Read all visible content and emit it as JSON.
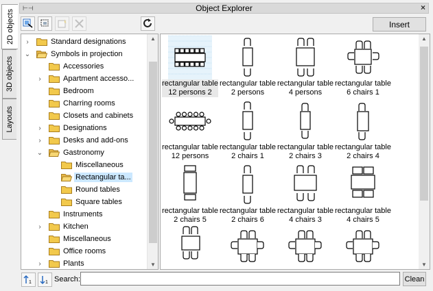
{
  "window": {
    "title": "Object Explorer"
  },
  "side_tabs": [
    {
      "label": "2D objects",
      "active": true
    },
    {
      "label": "3D objects",
      "active": false
    },
    {
      "label": "Layouts",
      "active": false
    }
  ],
  "toolbar": {
    "insert_label": "Insert"
  },
  "tree": {
    "items": [
      {
        "label": "Standard designations",
        "expander": "›",
        "open": false
      },
      {
        "label": "Symbols in projection",
        "expander": "⌄",
        "open": true
      },
      {
        "label": "Accessories",
        "expander": "",
        "open": false
      },
      {
        "label": "Apartment accesso...",
        "expander": "›",
        "open": false
      },
      {
        "label": "Bedroom",
        "expander": "",
        "open": false
      },
      {
        "label": "Charring rooms",
        "expander": "",
        "open": false
      },
      {
        "label": "Closets and cabinets",
        "expander": "",
        "open": false
      },
      {
        "label": "Designations",
        "expander": "›",
        "open": false
      },
      {
        "label": "Desks and add-ons",
        "expander": "›",
        "open": false
      },
      {
        "label": "Gastronomy",
        "expander": "⌄",
        "open": true
      },
      {
        "label": "Miscellaneous",
        "expander": "",
        "open": false
      },
      {
        "label": "Rectangular ta...",
        "expander": "",
        "open": true,
        "selected": true
      },
      {
        "label": "Round tables",
        "expander": "",
        "open": false
      },
      {
        "label": "Square tables",
        "expander": "",
        "open": false
      },
      {
        "label": "Instruments",
        "expander": "",
        "open": false
      },
      {
        "label": "Kitchen",
        "expander": "›",
        "open": false
      },
      {
        "label": "Miscellaneous",
        "expander": "",
        "open": false
      },
      {
        "label": "Office rooms",
        "expander": "",
        "open": false
      },
      {
        "label": "Plants",
        "expander": "›",
        "open": false
      }
    ]
  },
  "grid": {
    "items": [
      {
        "line1": "rectangular table",
        "line2": "12 persons 2",
        "selected": true
      },
      {
        "line1": "rectangular table",
        "line2": "2 persons"
      },
      {
        "line1": "rectangular table",
        "line2": "4 persons"
      },
      {
        "line1": "rectangular table",
        "line2": "6 chairs 1"
      },
      {
        "line1": "rectangular table",
        "line2": "12 persons"
      },
      {
        "line1": "rectangular table",
        "line2": "2 chairs 1"
      },
      {
        "line1": "rectangular table",
        "line2": "2 chairs 3"
      },
      {
        "line1": "rectangular table",
        "line2": "2 chairs 4"
      },
      {
        "line1": "rectangular table",
        "line2": "2 chairs 5"
      },
      {
        "line1": "rectangular table",
        "line2": "2 chairs 6"
      },
      {
        "line1": "rectangular table",
        "line2": "4 chairs 3"
      },
      {
        "line1": "rectangular table",
        "line2": "4 chairs 5"
      },
      {
        "line1": "",
        "line2": ""
      },
      {
        "line1": "",
        "line2": ""
      },
      {
        "line1": "",
        "line2": ""
      },
      {
        "line1": "",
        "line2": ""
      }
    ]
  },
  "search": {
    "label": "Search:",
    "value": "",
    "clean_label": "Clean"
  },
  "colors": {
    "selection": "#cce8ff",
    "folder": "#f2c94c"
  }
}
